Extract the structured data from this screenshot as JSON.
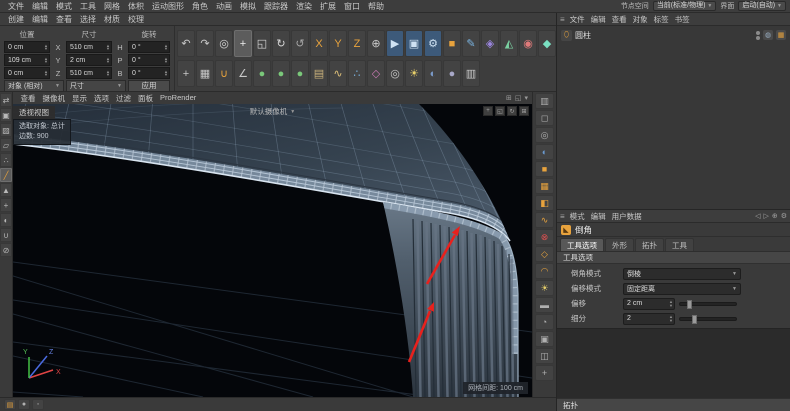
{
  "menubar": {
    "items": [
      "文件",
      "编辑",
      "模式",
      "工具",
      "网格",
      "体积",
      "运动图形",
      "角色",
      "动画",
      "模拟",
      "跟踪器",
      "渲染",
      "扩展",
      "窗口",
      "帮助"
    ],
    "right": {
      "node_space_label": "节点空间",
      "current": "当前(标准/物理)",
      "interface_label": "界面",
      "startup": "启动(自动)"
    }
  },
  "menubar2": {
    "items": [
      "创建",
      "编辑",
      "查看",
      "选择",
      "材质",
      "校理"
    ]
  },
  "coords": {
    "col_headers": [
      "位置",
      "尺寸",
      "旋转"
    ],
    "rows": [
      {
        "pos": "0 cm",
        "axis": "X",
        "size": "510 cm",
        "rot_axis": "H",
        "rot": "0 °"
      },
      {
        "pos": "109 cm",
        "axis": "Y",
        "size": "2 cm",
        "rot_axis": "P",
        "rot": "0 °"
      },
      {
        "pos": "0 cm",
        "axis": "Z",
        "size": "510 cm",
        "rot_axis": "B",
        "rot": "0 °"
      }
    ],
    "object_mode": "对象 (相对)",
    "size_mode": "尺寸",
    "apply_label": "应用"
  },
  "toolbar_row1": [
    {
      "n": "undo-icon",
      "g": "↶",
      "c": "#c8c8c8"
    },
    {
      "n": "redo-icon",
      "g": "↷",
      "c": "#c8c8c8"
    },
    {
      "n": "live-selection-icon",
      "g": "◎",
      "c": "#d8d8d8"
    },
    {
      "n": "move-icon",
      "g": "+",
      "c": "#eeeeee",
      "active": true
    },
    {
      "n": "scale-icon",
      "g": "◱",
      "c": "#d8d8d8"
    },
    {
      "n": "rotate-icon",
      "g": "↻",
      "c": "#d8d8d8"
    },
    {
      "n": "last-tool-icon",
      "g": "↺",
      "c": "#a8a8a8"
    },
    {
      "n": "lock-x-icon",
      "g": "X",
      "c": "#e8a33d"
    },
    {
      "n": "lock-y-icon",
      "g": "Y",
      "c": "#e8a33d"
    },
    {
      "n": "lock-z-icon",
      "g": "Z",
      "c": "#e8a33d"
    },
    {
      "n": "coord-system-icon",
      "g": "⊕",
      "c": "#c8c8c8"
    },
    {
      "n": "render-view-icon",
      "g": "▶",
      "c": "#cfe2f3",
      "bg": "#3d5a7a"
    },
    {
      "n": "render-picture-icon",
      "g": "▣",
      "c": "#cfe2f3",
      "bg": "#3d5a7a"
    },
    {
      "n": "render-settings-icon",
      "g": "⚙",
      "c": "#cfe2f3",
      "bg": "#3d5a7a"
    },
    {
      "n": "add-cube-icon",
      "g": "■",
      "c": "#e8a33d"
    },
    {
      "n": "pen-spline-icon",
      "g": "✎",
      "c": "#7ab3e0"
    },
    {
      "n": "subdivision-surface-icon",
      "g": "◈",
      "c": "#9b86e0"
    },
    {
      "n": "volume-builder-icon",
      "g": "◭",
      "c": "#7ad0a0"
    },
    {
      "n": "simulation-icon",
      "g": "◉",
      "c": "#e07a7a"
    },
    {
      "n": "mograph-icon",
      "g": "◆",
      "c": "#7ae0c2"
    }
  ],
  "toolbar_row2": [
    {
      "n": "modeling-axis-icon",
      "g": "+",
      "c": "#c8c8c8"
    },
    {
      "n": "workplane-icon",
      "g": "▦",
      "c": "#c8c8c8"
    },
    {
      "n": "snap-icon",
      "g": "∪",
      "c": "#e8a33d"
    },
    {
      "n": "quantize-icon",
      "g": "∠",
      "c": "#c8c8c8"
    },
    {
      "n": "dynamics-icon-1",
      "g": "●",
      "c": "#7ac87a"
    },
    {
      "n": "dynamics-icon-2",
      "g": "●",
      "c": "#7ac87a"
    },
    {
      "n": "dynamics-icon-3",
      "g": "●",
      "c": "#7ac87a"
    },
    {
      "n": "cloth-icon",
      "g": "▤",
      "c": "#c8b07a"
    },
    {
      "n": "hair-icon",
      "g": "∿",
      "c": "#e0c27a"
    },
    {
      "n": "particles-icon",
      "g": "∴",
      "c": "#7ab3e0"
    },
    {
      "n": "tracker-icon",
      "g": "◇",
      "c": "#c87ab3"
    },
    {
      "n": "camera-icon",
      "g": "◎",
      "c": "#c8c8c8"
    },
    {
      "n": "light-icon",
      "g": "☀",
      "c": "#e8d06a"
    },
    {
      "n": "environment-icon",
      "g": "◐",
      "c": "#7a9ac8"
    },
    {
      "n": "material-icon",
      "g": "●",
      "c": "#a8a8c8"
    },
    {
      "n": "display-filter-icon",
      "g": "▥",
      "c": "#c8c8c8"
    }
  ],
  "left_toolbar": [
    {
      "n": "convert-editable-icon",
      "g": "⇄",
      "c": "#b8b8b8"
    },
    {
      "n": "model-mode-icon",
      "g": "▣",
      "c": "#b8b8b8"
    },
    {
      "n": "texture-mode-icon",
      "g": "▨",
      "c": "#b8b8b8"
    },
    {
      "n": "workplane-mode-icon",
      "g": "▱",
      "c": "#b8b8b8"
    },
    {
      "n": "points-mode-icon",
      "g": "∴",
      "c": "#b8b8b8"
    },
    {
      "n": "edges-mode-icon",
      "g": "╱",
      "c": "#e8a33d",
      "active": true
    },
    {
      "n": "polygons-mode-icon",
      "g": "▲",
      "c": "#b8b8b8"
    },
    {
      "n": "enable-axis-icon",
      "g": "+",
      "c": "#b8b8b8"
    },
    {
      "n": "viewport-solo-icon",
      "g": "◐",
      "c": "#b8b8b8"
    },
    {
      "n": "snap-enable-icon",
      "g": "∪",
      "c": "#b8b8b8"
    },
    {
      "n": "lock-icon",
      "g": "⊘",
      "c": "#b8b8b8"
    }
  ],
  "mid_toolbar": [
    {
      "n": "view-setting-icon",
      "g": "▥",
      "c": "#b0b0b0"
    },
    {
      "n": "solo-icon",
      "g": "◻",
      "c": "#b0b0b0"
    },
    {
      "n": "camera-nav-icon",
      "g": "◎",
      "c": "#b0b0b0"
    },
    {
      "n": "globe-icon",
      "g": "◐",
      "c": "#6a9ad0"
    },
    {
      "n": "cube-primitive-icon",
      "g": "■",
      "c": "#e8a33d"
    },
    {
      "n": "array-icon",
      "g": "▦",
      "c": "#e8a33d"
    },
    {
      "n": "boole-icon",
      "g": "◧",
      "c": "#e8a33d"
    },
    {
      "n": "spline-icon",
      "g": "∿",
      "c": "#e8a33d"
    },
    {
      "n": "warning-icon",
      "g": "⊗",
      "c": "#e05050"
    },
    {
      "n": "deformer-icon",
      "g": "◇",
      "c": "#e8a33d"
    },
    {
      "n": "bend-icon",
      "g": "◠",
      "c": "#e8a33d"
    },
    {
      "n": "light-create-icon",
      "g": "☀",
      "c": "#e8d06a"
    },
    {
      "n": "floor-icon",
      "g": "▬",
      "c": "#b0b0b0"
    },
    {
      "n": "sky-icon",
      "g": "◔",
      "c": "#b0b0b0"
    },
    {
      "n": "stage-icon",
      "g": "▣",
      "c": "#b0b0b0"
    },
    {
      "n": "instance-icon",
      "g": "◫",
      "c": "#b0b0b0"
    },
    {
      "n": "null-icon",
      "g": "+",
      "c": "#b0b0b0"
    }
  ],
  "viewport": {
    "menu": [
      "查看",
      "摄像机",
      "显示",
      "选项",
      "过滤",
      "面板",
      "ProRender"
    ],
    "menu_icons": [
      {
        "n": "viewport-split-icon",
        "g": "⊞"
      },
      {
        "n": "viewport-maximize-icon",
        "g": "◱"
      },
      {
        "n": "viewport-options-icon",
        "g": "▾"
      }
    ],
    "view_label": "透视视图",
    "camera_label": "默认摄像机",
    "tooltip_line1": "选取对象: 总计",
    "tooltip_line2": "边数: 900",
    "grid_label": "网格间距: 100 cm",
    "corner_icons": [
      {
        "n": "move-view-icon",
        "g": "+"
      },
      {
        "n": "zoom-view-icon",
        "g": "◱"
      },
      {
        "n": "rotate-view-icon",
        "g": "↻"
      },
      {
        "n": "toggle-views-icon",
        "g": "⊞"
      }
    ],
    "axis": {
      "x": "X",
      "y": "Y",
      "z": "Z"
    }
  },
  "object_manager": {
    "menu": [
      "文件",
      "编辑",
      "查看",
      "对象",
      "标签",
      "书签"
    ],
    "objects": [
      {
        "label": "圆柱"
      }
    ]
  },
  "attributes": {
    "menu": [
      "模式",
      "编辑",
      "用户数据"
    ],
    "menu_icons": [
      {
        "n": "history-back-icon",
        "g": "◁"
      },
      {
        "n": "history-forward-icon",
        "g": "▷"
      },
      {
        "n": "lock-panel-icon",
        "g": "⊕"
      },
      {
        "n": "panel-settings-icon",
        "g": "⚙"
      }
    ],
    "title": "倒角",
    "tabs": [
      {
        "label": "工具选项",
        "active": true
      },
      {
        "label": "外形"
      },
      {
        "label": "拓扑"
      },
      {
        "label": "工具"
      }
    ],
    "section": "工具选项",
    "fields": [
      {
        "label": "倒角模式",
        "type": "select",
        "value": "倒棱"
      },
      {
        "label": "偏移模式",
        "type": "select",
        "value": "固定距离"
      },
      {
        "label": "偏移",
        "type": "number",
        "value": "2 cm",
        "slider": 0.15
      },
      {
        "label": "细分",
        "type": "number",
        "value": "2",
        "slider": 0.25
      }
    ],
    "bottom_section": "拓扑"
  },
  "statusbar": {
    "icons": [
      {
        "n": "status-layout-icon",
        "g": "▤",
        "c": "#e8a33d"
      },
      {
        "n": "status-record-icon",
        "g": "●",
        "c": "#b0b0b0"
      },
      {
        "n": "status-info-icon",
        "g": "◦",
        "c": "#b0b0b0"
      }
    ]
  }
}
